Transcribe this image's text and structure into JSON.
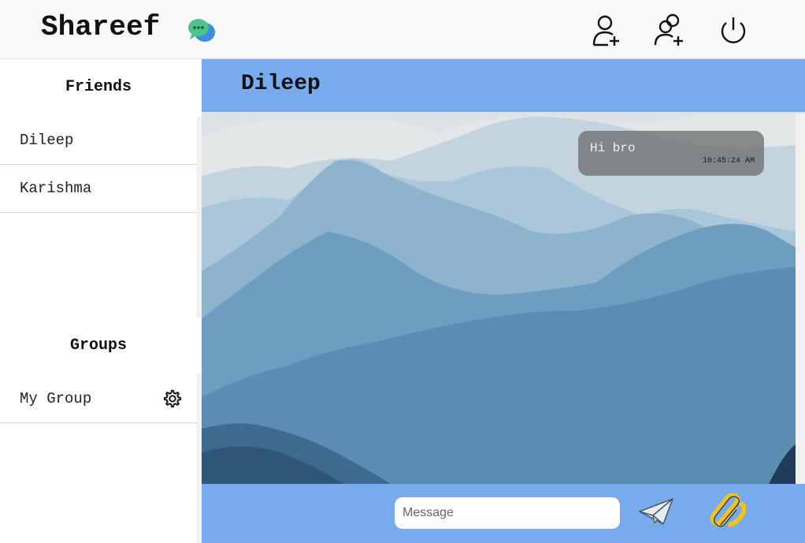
{
  "header": {
    "brand": "Shareef",
    "logo_icon": "chat-bubbles-icon",
    "actions": [
      {
        "name": "add-friend-icon"
      },
      {
        "name": "add-group-icon"
      },
      {
        "name": "power-icon"
      }
    ]
  },
  "sidebar": {
    "friends_title": "Friends",
    "friends": [
      {
        "label": "Dileep"
      },
      {
        "label": "Karishma"
      }
    ],
    "groups_title": "Groups",
    "groups": [
      {
        "label": "My Group",
        "icon": "gear-icon"
      }
    ]
  },
  "chat": {
    "title": "Dileep",
    "messages": [
      {
        "text": "Hi bro",
        "time": "10:45:24 AM"
      }
    ]
  },
  "composer": {
    "placeholder": "Message",
    "send_icon": "paper-plane-icon",
    "attach_icon": "paperclip-icon"
  },
  "colors": {
    "accent": "#78abee",
    "bubble": "#6e6e6e"
  }
}
